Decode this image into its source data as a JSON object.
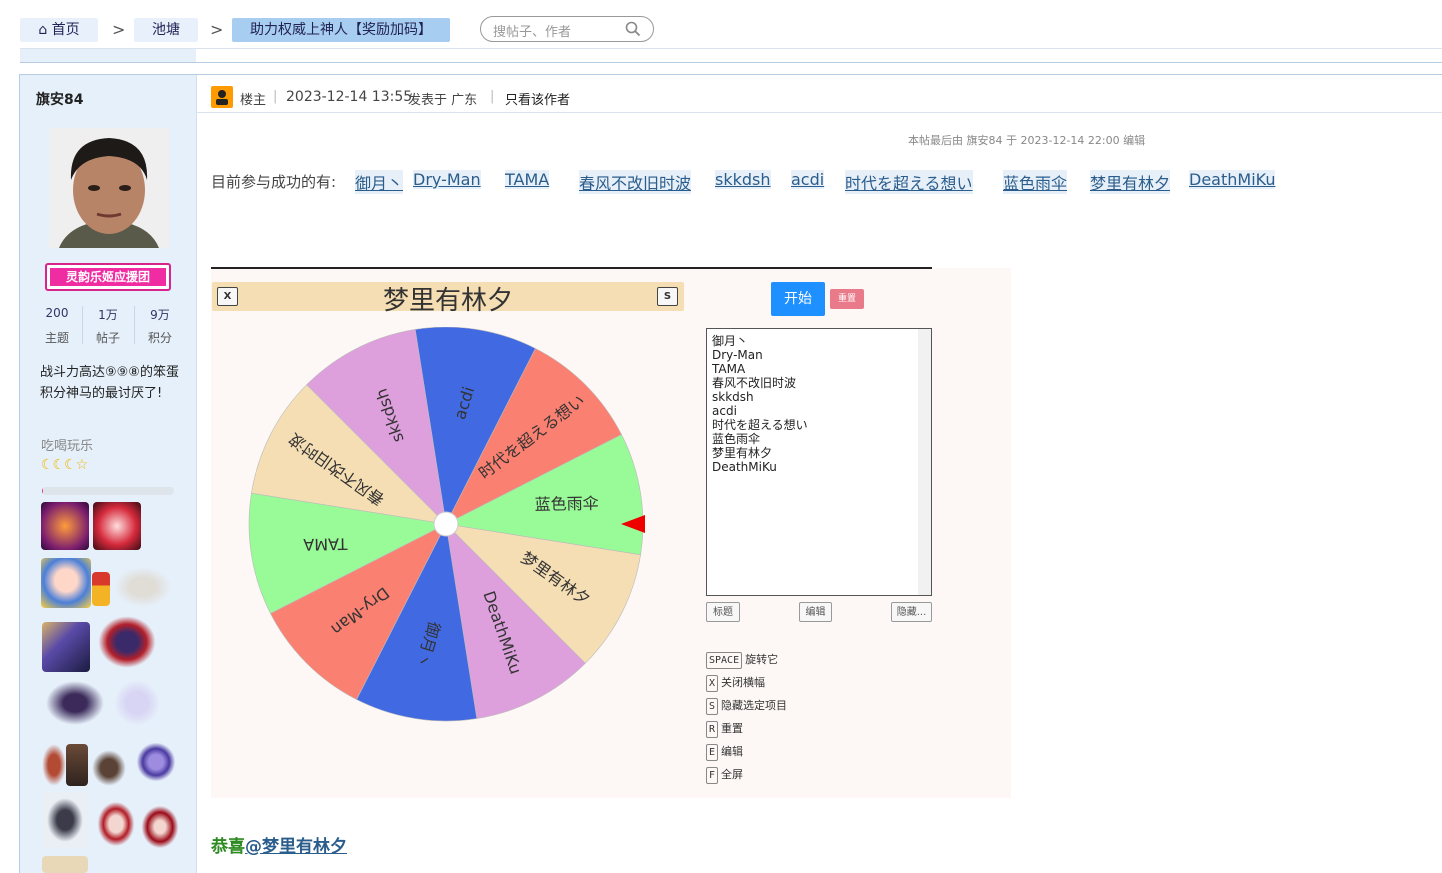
{
  "breadcrumb": {
    "home": "首页",
    "forum": "池塘",
    "thread": "助力权威上神人【奖励加码】",
    "separator": ">"
  },
  "search": {
    "placeholder": "搜帖子、作者"
  },
  "author": {
    "name": "旗安84",
    "group_badge": "灵韵乐姬应援团",
    "stats": [
      {
        "value": "200",
        "label": "主题"
      },
      {
        "value": "1万",
        "label": "帖子"
      },
      {
        "value": "9万",
        "label": "积分"
      }
    ],
    "signature": "战斗力高达⑨⑨⑧的笨蛋积分神马的最讨厌了!",
    "rank": "吃喝玩乐",
    "rank_stars": "☾☾☾☆",
    "progress": 0.01
  },
  "post": {
    "floor_label": "楼主",
    "date": "2023-12-14 13:55",
    "posted_in": "发表于 广东",
    "only_author": "只看该作者",
    "edit_note": "本帖最后由 旗安84 于 2023-12-14 22:00 编辑",
    "participants_label": "目前参与成功的有:",
    "participants": [
      "御月丶",
      "Dry-Man",
      "TAMA",
      "春风不改旧时波",
      "skkdsh",
      "acdi",
      "时代を超える想い",
      "蓝色雨伞",
      "梦里有林夕",
      "DeathMiKu"
    ],
    "congrats_prefix": "恭喜",
    "congrats_mention": "@梦里有林夕"
  },
  "wheel_app": {
    "title": "梦里有林夕",
    "close_key": "X",
    "hide_key": "S",
    "start_label": "开始",
    "reset_label": "重置",
    "list_text": "御月丶\nDry-Man\nTAMA\n春风不改旧时波\nskkdsh\nacdi\n时代を超える想い\n蓝色雨伞\n梦里有林夕\nDeathMiKu",
    "tab_title": "标题",
    "tab_edit": "编辑",
    "tab_hide": "隐藏...",
    "shortcuts": [
      {
        "key": "SPACE",
        "desc": "旋转它"
      },
      {
        "key": "X",
        "desc": "关闭横幅"
      },
      {
        "key": "S",
        "desc": "隐藏选定项目"
      },
      {
        "key": "R",
        "desc": "重置"
      },
      {
        "key": "E",
        "desc": "编辑"
      },
      {
        "key": "F",
        "desc": "全屏"
      }
    ],
    "segments": [
      {
        "label": "acdi",
        "color": "#4169e1"
      },
      {
        "label": "时代を超える想い",
        "color": "#fa8072"
      },
      {
        "label": "蓝色雨伞",
        "color": "#98fb98"
      },
      {
        "label": "梦里有林夕",
        "color": "#f5deb3"
      },
      {
        "label": "DeathMiKu",
        "color": "#dda0dd"
      },
      {
        "label": "御月丶",
        "color": "#4169e1"
      },
      {
        "label": "Dry-Man",
        "color": "#fa8072"
      },
      {
        "label": "TAMA",
        "color": "#98fb98"
      },
      {
        "label": "春风不改旧时波",
        "color": "#f5deb3"
      },
      {
        "label": "skkdsh",
        "color": "#dda0dd"
      }
    ],
    "pointer_color": "#ee0000"
  }
}
